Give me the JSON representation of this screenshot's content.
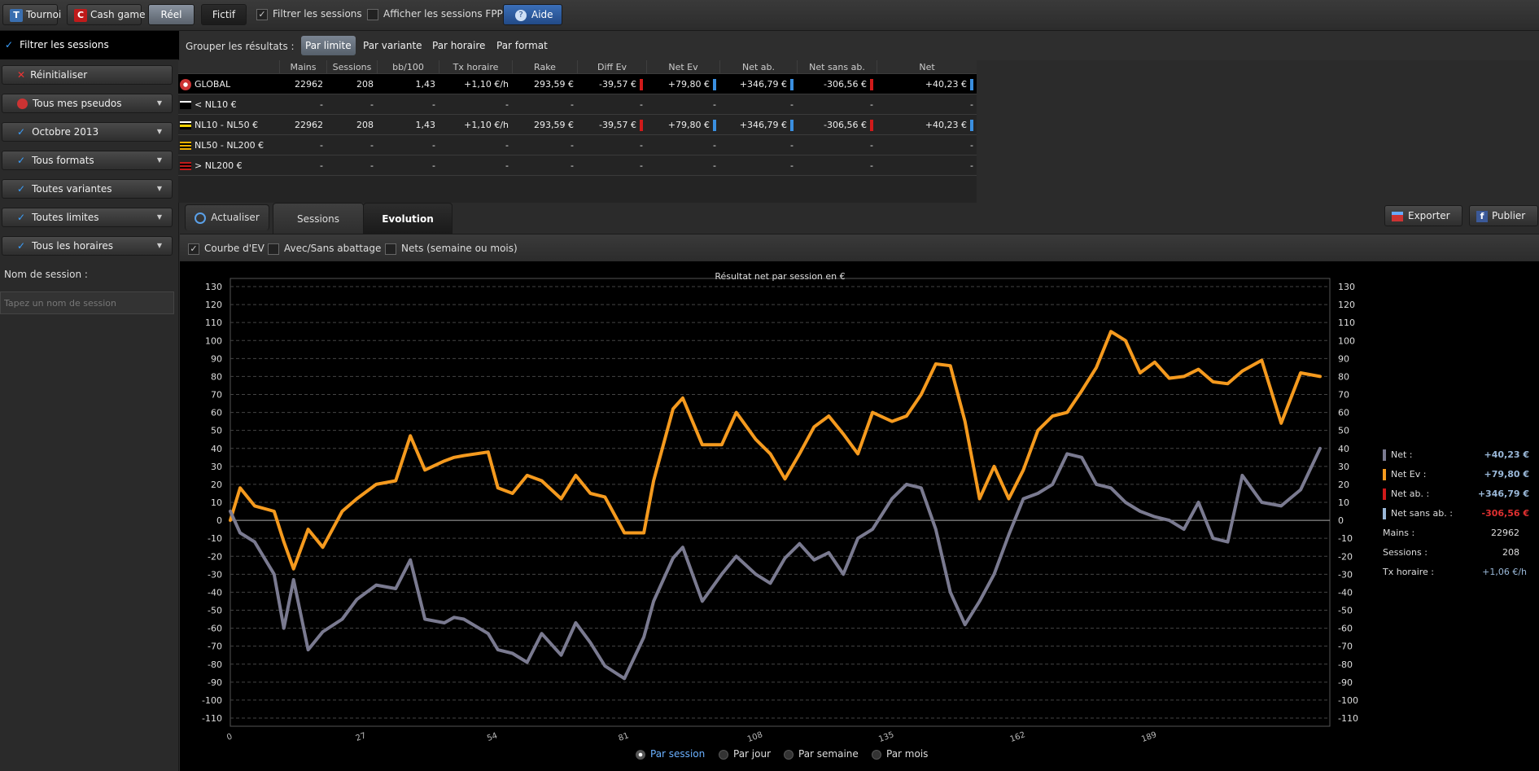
{
  "topbar": {
    "tournoi": "Tournoi",
    "tournoi_badge": "T",
    "cash": "Cash game",
    "cash_badge": "C",
    "reel": "Réel",
    "fictif": "Fictif",
    "filter_sessions": "Filtrer les sessions",
    "filter_sessions_checked": true,
    "fpp": "Afficher les sessions FPP",
    "fpp_checked": false,
    "help": "Aide"
  },
  "sidebar": {
    "title": "Filtrer les sessions",
    "reset": "Réinitialiser",
    "filters": [
      "Tous mes pseudos",
      "Octobre 2013",
      "Tous formats",
      "Toutes variantes",
      "Toutes limites",
      "Tous les horaires"
    ],
    "session_label": "Nom de session :",
    "session_placeholder": "Tapez un nom de session"
  },
  "groupbar": {
    "label": "Grouper les résultats :",
    "options": [
      "Par limite",
      "Par variante",
      "Par horaire",
      "Par format"
    ],
    "active": "Par limite"
  },
  "table": {
    "headers": [
      "Mains",
      "Sessions",
      "bb/100",
      "Tx horaire",
      "Rake",
      "Diff Ev",
      "Net Ev",
      "Net ab.",
      "Net sans ab.",
      "Net"
    ],
    "rows": [
      {
        "name": "GLOBAL",
        "cells": [
          "22962",
          "208",
          "1,43",
          "+1,10 €/h",
          "293,59 €",
          "-39,57 €",
          "+79,80 €",
          "+346,79 €",
          "-306,56 €",
          "+40,23 €"
        ]
      },
      {
        "name": "< NL10 €",
        "cells": [
          "-",
          "-",
          "-",
          "-",
          "-",
          "-",
          "-",
          "-",
          "-",
          "-"
        ]
      },
      {
        "name": "NL10 - NL50 €",
        "cells": [
          "22962",
          "208",
          "1,43",
          "+1,10 €/h",
          "293,59 €",
          "-39,57 €",
          "+79,80 €",
          "+346,79 €",
          "-306,56 €",
          "+40,23 €"
        ]
      },
      {
        "name": "NL50 - NL200 €",
        "cells": [
          "-",
          "-",
          "-",
          "-",
          "-",
          "-",
          "-",
          "-",
          "-",
          "-"
        ]
      },
      {
        "name": "> NL200 €",
        "cells": [
          "-",
          "-",
          "-",
          "-",
          "-",
          "-",
          "-",
          "-",
          "-",
          "-"
        ]
      }
    ]
  },
  "tabs": {
    "refresh": "Actualiser",
    "sessions": "Sessions",
    "evolution": "Evolution",
    "export": "Exporter",
    "publish": "Publier"
  },
  "options": {
    "ev_curve": "Courbe d'EV",
    "ev_curve_checked": true,
    "abattage": "Avec/Sans abattage",
    "abattage_checked": false,
    "nets": "Nets (semaine ou mois)",
    "nets_checked": false
  },
  "legend": {
    "net_label": "Net :",
    "net_value": "+40,23 €",
    "netev_label": "Net Ev :",
    "netev_value": "+79,80 €",
    "netab_label": "Net ab. :",
    "netab_value": "+346,79 €",
    "netsans_label": "Net sans ab. :",
    "netsans_value": "-306,56 €",
    "mains_label": "Mains :",
    "mains_value": "22962",
    "sessions_label": "Sessions :",
    "sessions_value": "208",
    "tx_label": "Tx horaire :",
    "tx_value": "+1,06 €/h"
  },
  "period": {
    "options": [
      "Par session",
      "Par jour",
      "Par semaine",
      "Par mois"
    ],
    "active": "Par session"
  },
  "colors": {
    "net": "#7a7a90",
    "netev": "#f59a1e",
    "netab": "#d01a1a",
    "netsans": "#9ab8d8",
    "accent_blue": "#3a8fe0"
  },
  "chart_data": {
    "type": "line",
    "title": "Résultat net par session en €",
    "ylim": [
      -110,
      130
    ],
    "yticks": [
      130,
      120,
      110,
      100,
      90,
      80,
      70,
      60,
      50,
      40,
      30,
      20,
      10,
      0,
      -10,
      -20,
      -30,
      -40,
      -50,
      -60,
      -70,
      -80,
      -90,
      -100,
      -110
    ],
    "xticks": [
      "0",
      "27",
      "54",
      "81",
      "108",
      "135",
      "162",
      "189"
    ],
    "xlim": [
      0,
      226
    ],
    "series": [
      {
        "name": "Net Ev",
        "color": "#f59a1e",
        "x": [
          0,
          2,
          5,
          9,
          11,
          13,
          16,
          19,
          23,
          26,
          30,
          34,
          37,
          40,
          44,
          46,
          48,
          53,
          55,
          58,
          61,
          64,
          68,
          71,
          74,
          77,
          81,
          85,
          87,
          91,
          93,
          97,
          101,
          104,
          108,
          111,
          114,
          117,
          120,
          123,
          126,
          129,
          132,
          136,
          139,
          142,
          145,
          148,
          151,
          154,
          157,
          160,
          163,
          166,
          169,
          172,
          175,
          178,
          181,
          184,
          187,
          190,
          193,
          196,
          199,
          202,
          205,
          208,
          212,
          216,
          220,
          224
        ],
        "y": [
          0,
          18,
          8,
          5,
          -12,
          -27,
          -5,
          -15,
          5,
          12,
          20,
          22,
          47,
          28,
          33,
          35,
          36,
          38,
          18,
          15,
          25,
          22,
          12,
          25,
          15,
          13,
          -7,
          -7,
          22,
          62,
          68,
          42,
          42,
          60,
          45,
          37,
          23,
          37,
          52,
          58,
          48,
          37,
          60,
          55,
          58,
          70,
          87,
          86,
          55,
          12,
          30,
          12,
          28,
          50,
          58,
          60,
          72,
          85,
          105,
          100,
          82,
          88,
          79,
          80,
          84,
          77,
          76,
          83,
          89,
          54,
          82,
          80
        ]
      },
      {
        "name": "Net",
        "color": "#7a7a90",
        "x": [
          0,
          2,
          5,
          9,
          11,
          13,
          16,
          19,
          23,
          26,
          30,
          34,
          37,
          40,
          44,
          46,
          48,
          53,
          55,
          58,
          61,
          64,
          68,
          71,
          74,
          77,
          81,
          85,
          87,
          91,
          93,
          97,
          101,
          104,
          108,
          111,
          114,
          117,
          120,
          123,
          126,
          129,
          132,
          136,
          139,
          142,
          145,
          148,
          151,
          154,
          157,
          160,
          163,
          166,
          169,
          172,
          175,
          178,
          181,
          184,
          187,
          190,
          193,
          196,
          199,
          202,
          205,
          208,
          212,
          216,
          220,
          224
        ],
        "y": [
          5,
          -7,
          -12,
          -30,
          -60,
          -33,
          -72,
          -62,
          -55,
          -44,
          -36,
          -38,
          -22,
          -55,
          -57,
          -54,
          -55,
          -63,
          -72,
          -74,
          -79,
          -63,
          -75,
          -57,
          -68,
          -81,
          -88,
          -65,
          -45,
          -21,
          -15,
          -45,
          -30,
          -20,
          -30,
          -35,
          -21,
          -13,
          -22,
          -18,
          -30,
          -10,
          -5,
          12,
          20,
          18,
          -5,
          -40,
          -58,
          -45,
          -30,
          -8,
          12,
          15,
          20,
          37,
          35,
          20,
          18,
          10,
          5,
          2,
          0,
          -5,
          10,
          -10,
          -12,
          25,
          10,
          8,
          17,
          40
        ]
      }
    ],
    "right_axis": true
  }
}
